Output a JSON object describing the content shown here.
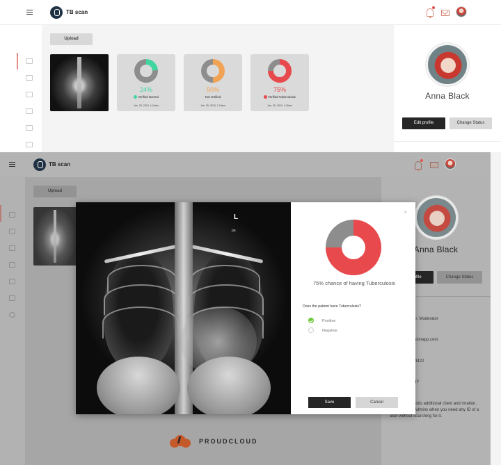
{
  "app": {
    "title": "TB scan"
  },
  "toolbar": {
    "upload_label": "Upload"
  },
  "results": [
    {
      "percent": "24%",
      "percent_value": 24,
      "status": "Verified Normal",
      "date": "Jan. 25, 2019, 1:16am",
      "color": "#3fd6a0",
      "status_color": "#3fd6a0"
    },
    {
      "percent": "50%",
      "percent_value": 50,
      "status": "Not Verified",
      "date": "Jan. 25, 2019, 1:16am",
      "color": "#f0a354",
      "status_color": ""
    },
    {
      "percent": "75%",
      "percent_value": 75,
      "status": "Verified Tuberculosis",
      "date": "Jan. 25, 2019, 1:16am",
      "color": "#e8494c",
      "status_color": "#e8494c"
    }
  ],
  "profile": {
    "name": "Anna Black",
    "edit_label": "Edit profile",
    "status_label": "Change Status",
    "role": "or, Moderator",
    "email": "isionapp.com",
    "phone": "-4422",
    "city": "NY",
    "note": "adds additional client and rmation. It's useful for Admins when you need any ID of a user without searching for it."
  },
  "modal": {
    "marker_l": "L",
    "marker_pa": "pa",
    "chance_text": "75% chance of having Tuberculosis",
    "chance_value": 75,
    "question": "Does the patient have Tuberculosis?",
    "options": [
      "Positive",
      "Negative"
    ],
    "selected": "Positive",
    "save_label": "Save",
    "cancel_label": "Cancel",
    "close_glyph": "×"
  },
  "brand": {
    "name": "PROUDCLOUD"
  },
  "colors": {
    "normal": "#3fd6a0",
    "pending": "#f0a354",
    "tb": "#e8494c",
    "dark_button": "#262626"
  }
}
